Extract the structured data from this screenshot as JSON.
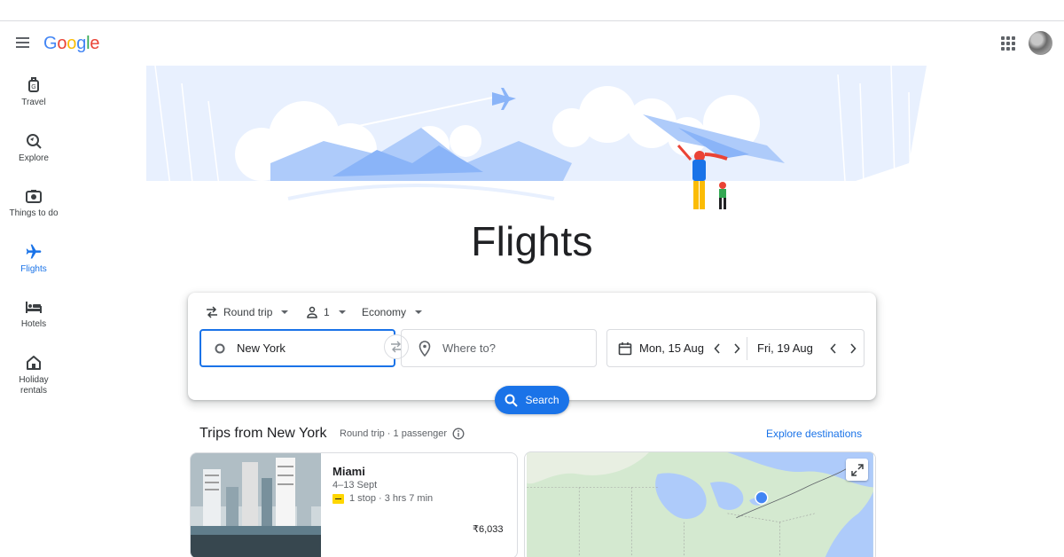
{
  "header": {
    "logo_letters": [
      "G",
      "o",
      "o",
      "g",
      "l",
      "e"
    ]
  },
  "sidebar": {
    "items": [
      {
        "label": "Travel",
        "icon": "travel-icon"
      },
      {
        "label": "Explore",
        "icon": "explore-icon"
      },
      {
        "label": "Things to do",
        "icon": "camera-icon"
      },
      {
        "label": "Flights",
        "icon": "airplane-icon",
        "active": true
      },
      {
        "label": "Hotels",
        "icon": "bed-icon"
      },
      {
        "label": "Holiday rentals",
        "icon": "house-icon"
      }
    ]
  },
  "hero": {
    "title": "Flights"
  },
  "search": {
    "trip_type": "Round trip",
    "passengers": "1",
    "cabin_class": "Economy",
    "origin_value": "New York",
    "destination_placeholder": "Where to?",
    "depart_date": "Mon, 15 Aug",
    "return_date": "Fri, 19 Aug",
    "search_label": "Search"
  },
  "trips": {
    "title": "Trips from New York",
    "meta": "Round trip · 1 passenger",
    "explore_link": "Explore destinations",
    "cards": [
      {
        "city": "Miami",
        "dates": "4–13 Sept",
        "stops": "1 stop · 3 hrs 7 min",
        "price": "₹6,033"
      }
    ]
  },
  "colors": {
    "accent": "#1a73e8",
    "text": "#202124",
    "muted": "#5f6368",
    "hero_blue": "#aecbfa"
  }
}
